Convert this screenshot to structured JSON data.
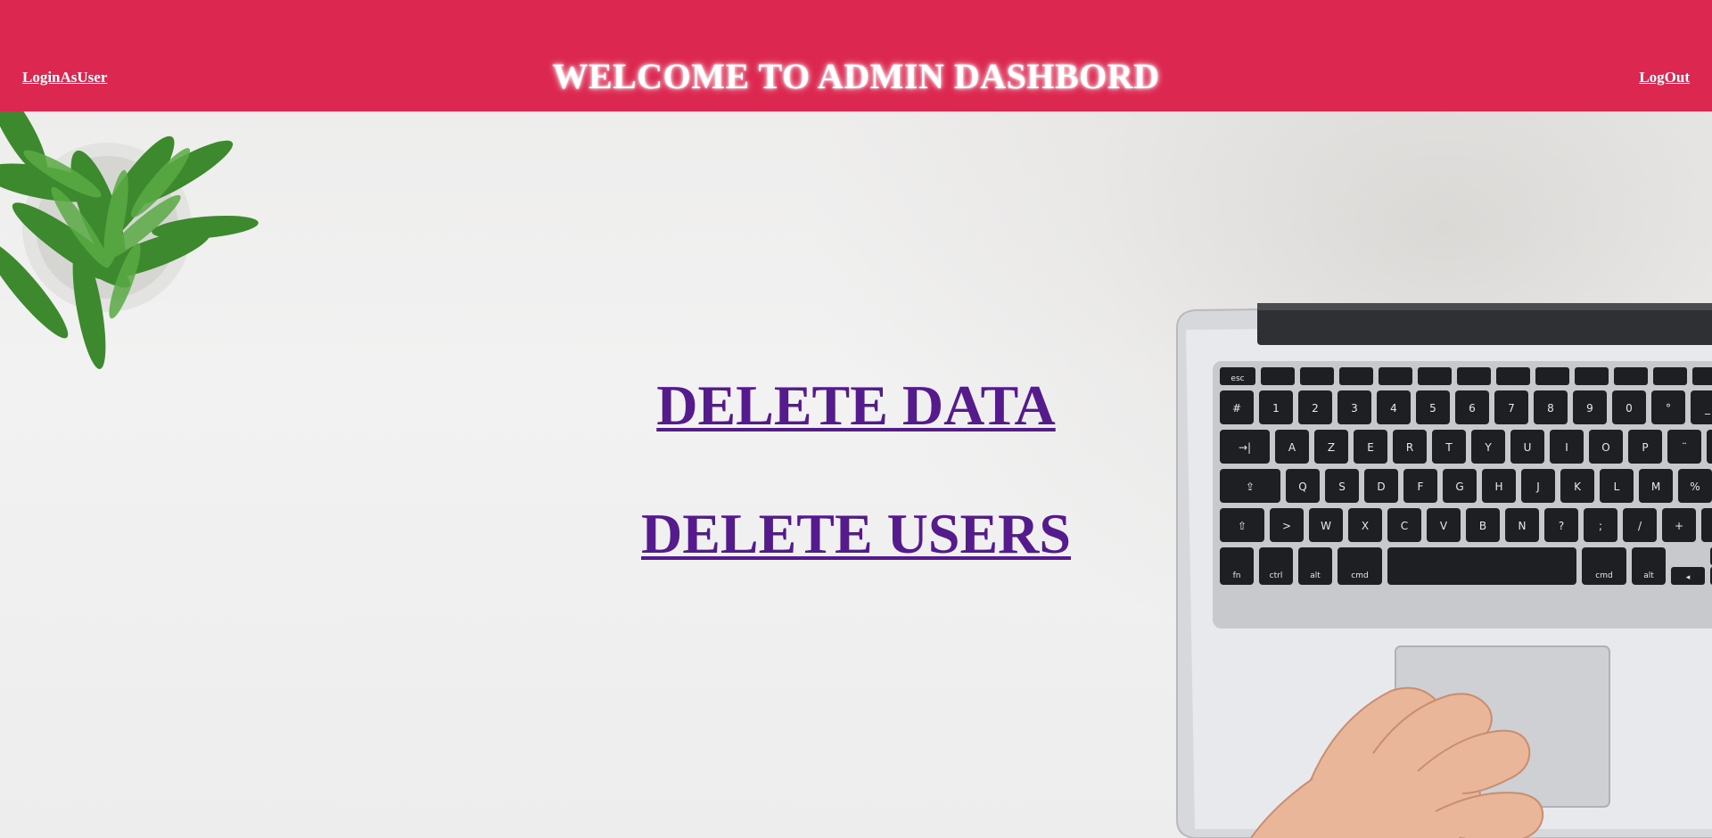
{
  "header": {
    "title": "WELCOME TO ADMIN DASHBORD",
    "login_as_user_label": "LoginAsUser",
    "logout_label": "LogOut",
    "background_color": "#dc2850"
  },
  "main": {
    "delete_data_label": "DELETE DATA",
    "delete_users_label": "DELETE USERS",
    "link_color": "#551a8b"
  },
  "keyboard": {
    "row1": [
      "esc",
      "",
      "",
      "",
      "",
      "",
      "",
      "",
      "",
      "",
      "",
      "",
      ""
    ],
    "row2": [
      "#",
      "1",
      "2",
      "3",
      "4",
      "5",
      "6",
      "7",
      "8",
      "9",
      "0",
      "°",
      "_"
    ],
    "row3": [
      "→|",
      "A",
      "Z",
      "E",
      "R",
      "T",
      "Y",
      "U",
      "I",
      "O",
      "P",
      "¨",
      "*"
    ],
    "row4": [
      "⇪",
      "Q",
      "S",
      "D",
      "F",
      "G",
      "H",
      "J",
      "K",
      "L",
      "M",
      "%"
    ],
    "row5": [
      "⇧",
      ">",
      "W",
      "X",
      "C",
      "V",
      "B",
      "N",
      "?",
      ";",
      "/",
      "+"
    ],
    "row6": [
      "fn",
      "ctrl",
      "alt",
      "cmd",
      "",
      "cmd",
      "alt",
      "◂"
    ]
  }
}
